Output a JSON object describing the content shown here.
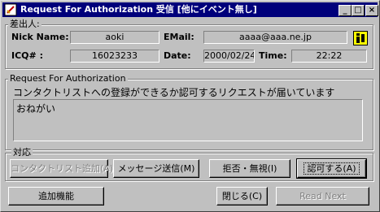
{
  "window": {
    "title": "Request For Authorization 受信 [他にイベント無し]",
    "controls": {
      "minimize": "_",
      "maximize": "□",
      "close": "×"
    }
  },
  "sender": {
    "group_label": "差出人:",
    "nick_label": "Nick Name:",
    "nick_value": "aoki",
    "email_label": "EMail:",
    "email_value": "aaaa@aaa.ne.jp",
    "icq_label": "ICQ# :",
    "icq_value": "16023233",
    "date_label": "Date:",
    "date_value": "2000/02/24",
    "time_label": "Time:",
    "time_value": "22:22"
  },
  "request": {
    "group_label": "Request For Authorization",
    "description": "コンタクトリストへの登録ができるか認可するリクエストが届いています",
    "message": "おねがい"
  },
  "actions": {
    "group_label": "対応",
    "add_contact": "コンタクトリスト追加(A)",
    "send_message": "メッセージ送信(M)",
    "reject_ignore": "拒否・無視(I)",
    "authorize": "認可する(A)"
  },
  "footer": {
    "extra_functions": "追加機能",
    "close": "閉じる(C)",
    "read_next": "Read Next"
  },
  "colors": {
    "titlebar": "#00007b",
    "face": "#c0c0c0"
  }
}
